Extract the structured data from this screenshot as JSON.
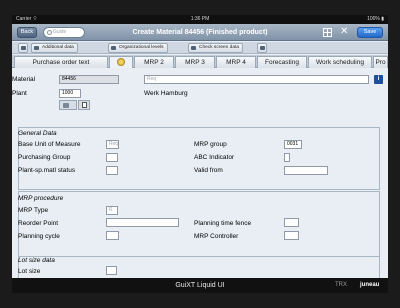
{
  "status_bar": {
    "carrier": "Carrier ⌔",
    "time": "1:36 PM",
    "battery": "100% ▮"
  },
  "nav": {
    "back_label": "Back",
    "search_placeholder": "Guide",
    "title": "Create Material 84456 (Finished product)",
    "save_label": "Save"
  },
  "toolbar": {
    "additional_data": "Additional data",
    "org_levels": "Organizational levels",
    "check_screen_data": "Check screen data"
  },
  "tabs": [
    "Purchase order text",
    "",
    "MRP 2",
    "MRP 3",
    "MRP 4",
    "Forecasting",
    "Work scheduling",
    "Pro"
  ],
  "header": {
    "material_label": "Material",
    "material_value": "84456",
    "description_placeholder": "Req",
    "plant_label": "Plant",
    "plant_value": "1000",
    "plant_name": "Werk Hamburg"
  },
  "general_data": {
    "title": "General Data",
    "base_uom_label": "Base Unit of Measure",
    "base_uom_placeholder": "Req",
    "mrp_group_label": "MRP group",
    "mrp_group_value": "0031",
    "purchasing_group_label": "Purchasing Group",
    "abc_indicator_label": "ABC Indicator",
    "plant_sp_status_label": "Plant-sp.matl status",
    "valid_from_label": "Valid from"
  },
  "mrp_procedure": {
    "title": "MRP procedure",
    "mrp_type_label": "MRP Type",
    "mrp_type_placeholder": "R",
    "reorder_point_label": "Reorder Point",
    "planning_time_fence_label": "Planning time fence",
    "planning_cycle_label": "Planning cycle",
    "mrp_controller_label": "MRP Controller"
  },
  "lot_size_data": {
    "title": "Lot size data",
    "lot_size_label": "Lot size"
  },
  "bottom_bar": {
    "brand": "GuiXT Liquid UI",
    "transaction": "TRX",
    "system": "juneau"
  },
  "colors": {
    "title_bar": "#8fa1b5",
    "save_button": "#2f79d8",
    "info_button": "#1d4f9b",
    "background": "#e9eef4"
  }
}
